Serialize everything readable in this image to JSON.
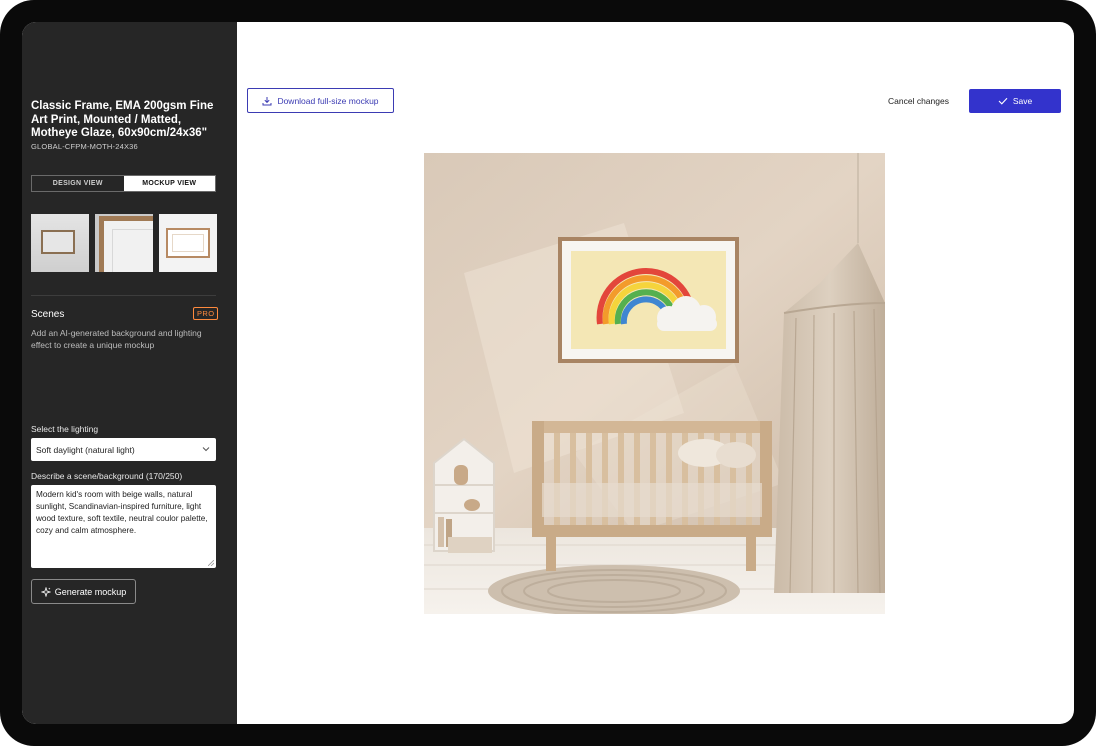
{
  "product": {
    "title": "Classic Frame, EMA 200gsm Fine Art Print, Mounted / Matted, Motheye Glaze, 60x90cm/24x36\"",
    "sku": "GLOBAL-CFPM-MOTH-24X36"
  },
  "view_toggle": {
    "design_label": "DESIGN VIEW",
    "mockup_label": "MOCKUP VIEW",
    "active": "MOCKUP VIEW"
  },
  "thumbnails": [
    "wall-frame-thumbnail",
    "frame-closeup-thumbnail",
    "frame-flat-thumbnail"
  ],
  "scenes": {
    "label": "Scenes",
    "badge": "PRO",
    "description": "Add an AI-generated background and lighting effect to create a unique mockup"
  },
  "lighting": {
    "label": "Select the lighting",
    "selected": "Soft daylight (natural light)"
  },
  "scene_description": {
    "label": "Describe a scene/background (170/250)",
    "value": "Modern kid's room with beige walls, natural sunlight, Scandinavian-inspired furniture, light wood texture, soft textile, neutral coulor palette, cozy and calm atmosphere."
  },
  "generate_button": {
    "label": "Generate mockup",
    "icon": "sparkle-icon"
  },
  "toolbar": {
    "download_label": "Download full-size mockup",
    "download_icon": "download-icon",
    "cancel_label": "Cancel changes",
    "save_label": "Save",
    "save_icon": "check-icon"
  },
  "colors": {
    "sidebar_bg": "#262626",
    "accent": "#3333cc",
    "pro_badge": "#ff8a3d"
  }
}
